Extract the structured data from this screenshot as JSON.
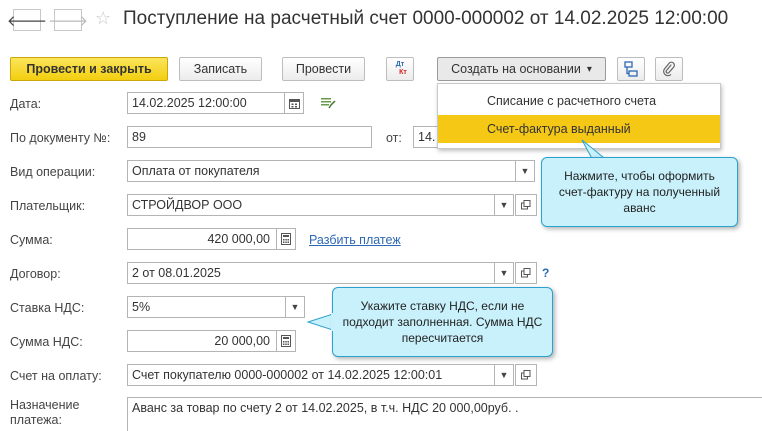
{
  "title": "Поступление на расчетный счет 0000-000002 от 14.02.2025 12:00:00",
  "nav": {
    "back_glyph": "🡐",
    "forward_glyph": "🡒",
    "favorite_glyph": "☆"
  },
  "toolbar": {
    "post_and_close": "Провести и закрыть",
    "save": "Записать",
    "post": "Провести",
    "dt_kt_top": "Дт",
    "dt_kt_bottom": "Кт",
    "create_based_on": "Создать на основании",
    "create_based_on_arrow": "▾"
  },
  "dropdown": {
    "items": [
      {
        "label": "Списание с расчетного счета",
        "active": false
      },
      {
        "label": "Счет-фактура выданный",
        "active": true
      }
    ]
  },
  "form": {
    "date": {
      "label": "Дата:",
      "value": "14.02.2025 12:00:00"
    },
    "doc_number": {
      "label": "По документу №:",
      "value": "89",
      "from_label": "от:",
      "from_value": "14."
    },
    "operation_type": {
      "label": "Вид операции:",
      "value": "Оплата от покупателя"
    },
    "payer": {
      "label": "Плательщик:",
      "value": "СТРОЙДВОР ООО"
    },
    "amount": {
      "label": "Сумма:",
      "value": "420 000,00",
      "split_link": "Разбить платеж"
    },
    "contract": {
      "label": "Договор:",
      "value": "2 от 08.01.2025",
      "help": "?"
    },
    "vat_rate": {
      "label": "Ставка НДС:",
      "value": "5%"
    },
    "vat_amount": {
      "label": "Сумма НДС:",
      "value": "20 000,00"
    },
    "invoice": {
      "label": "Счет на оплату:",
      "value": "Счет покупателю 0000-000002 от 14.02.2025 12:00:01"
    },
    "purpose": {
      "label_line1": "Назначение",
      "label_line2": "платежа:",
      "value": "Аванс за товар по счету 2 от 14.02.2025, в т.ч. НДС 20 000,00руб.  ."
    }
  },
  "tooltips": {
    "invoice_tip": "Нажмите, чтобы оформить счет-фактуру на полученный аванс",
    "vat_tip": "Укажите ставку НДС, если не подходит заполненная. Сумма НДС пересчитается"
  },
  "colors": {
    "primary_button": "#f3cf10",
    "menu_highlight": "#f5c816",
    "tooltip_bg": "#c8f1fb",
    "tooltip_border": "#2aa1cf",
    "link": "#2d68b4"
  }
}
